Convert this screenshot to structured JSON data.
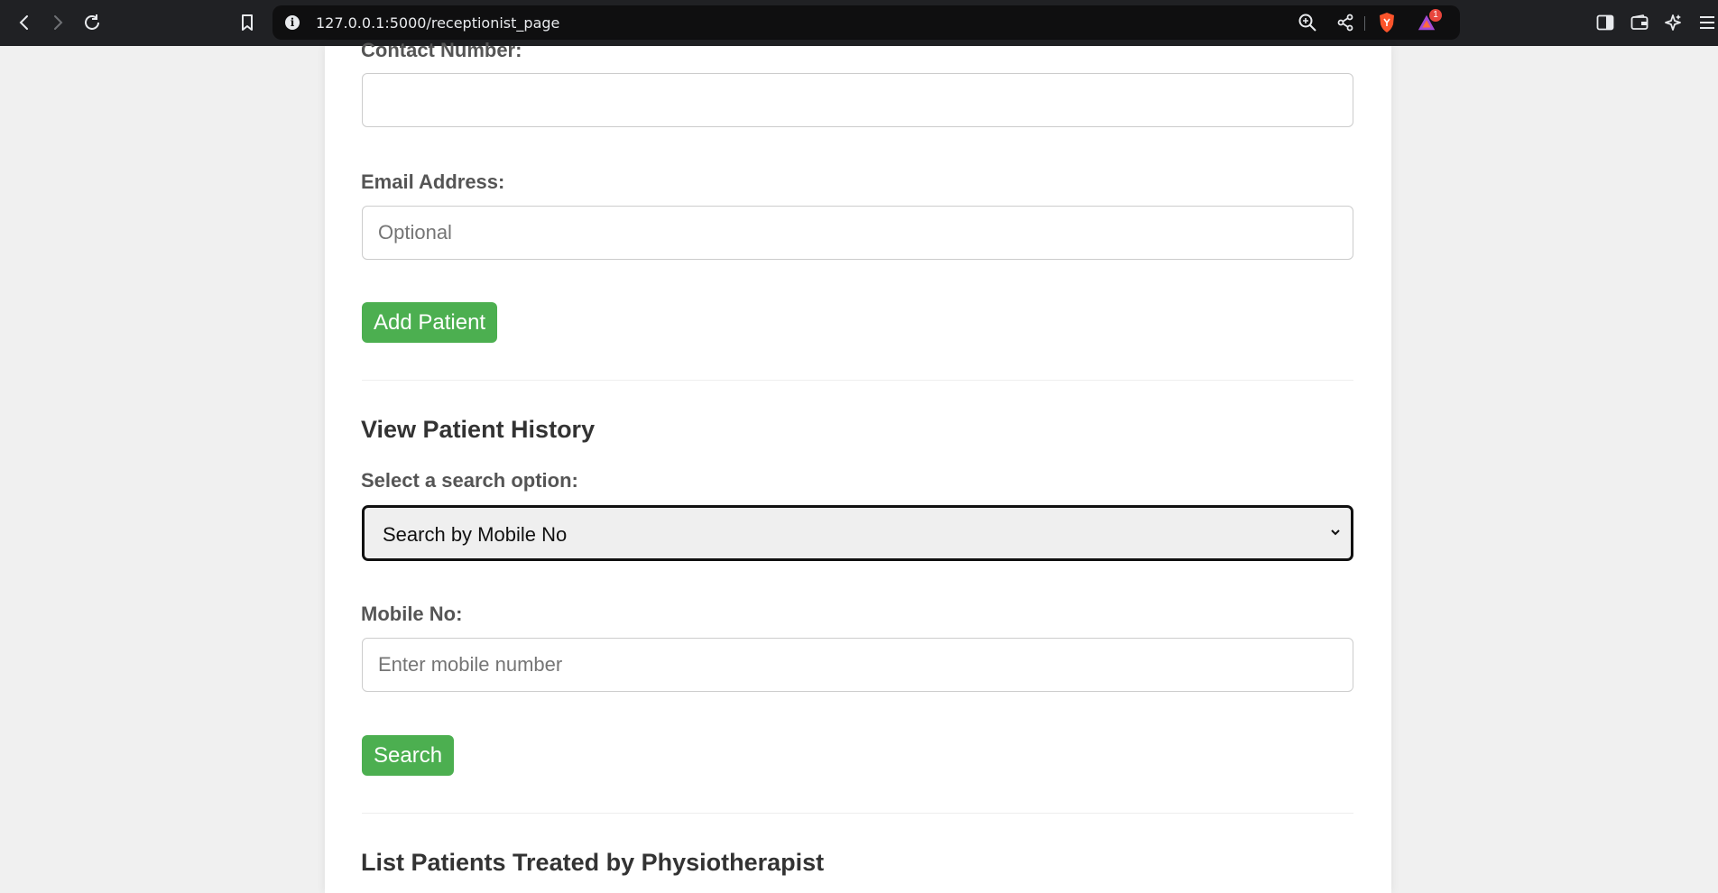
{
  "browser": {
    "url": "127.0.0.1:5000/receptionist_page",
    "notification_count": "1",
    "icons": [
      "back-icon",
      "forward-icon",
      "reload-icon",
      "bookmark-icon",
      "site-info-icon",
      "zoom-icon",
      "share-icon",
      "brave-shields-icon",
      "brave-rewards-icon",
      "sidebar-icon",
      "wallet-icon",
      "leo-ai-icon",
      "menu-icon"
    ]
  },
  "form": {
    "contact_label": "Contact Number:",
    "contact_value": "",
    "email_label": "Email Address:",
    "email_placeholder": "Optional",
    "add_patient_button": "Add Patient"
  },
  "history": {
    "title": "View Patient History",
    "search_option_label": "Select a search option:",
    "search_option_selected": "Search by Mobile No",
    "mobile_label": "Mobile No:",
    "mobile_placeholder": "Enter mobile number",
    "search_button": "Search"
  },
  "physio": {
    "title": "List Patients Treated by Physiotherapist"
  },
  "colors": {
    "accent_green": "#4caf50",
    "chrome_bg": "#202124",
    "page_bg": "#f0f0f0"
  }
}
